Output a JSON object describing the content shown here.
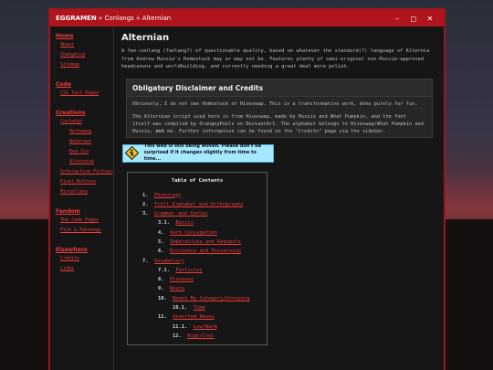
{
  "window": {
    "breadcrumb": [
      "EGGRAMEN",
      "Conlangs",
      "Alternian"
    ],
    "separator": "»",
    "controls": {
      "minimize": "–",
      "maximize": "◻",
      "close": "✕"
    }
  },
  "sidebar": {
    "sections": [
      {
        "heading": "Home",
        "items": [
          {
            "label": "About",
            "level": 1
          },
          {
            "label": "Changelog",
            "level": 1
          },
          {
            "label": "Sitemap",
            "level": 1
          }
        ]
      },
      {
        "heading": "Code",
        "items": [
          {
            "label": "CSS Test Pages",
            "level": 1
          }
        ]
      },
      {
        "heading": "Creations",
        "items": [
          {
            "label": "Conlangs",
            "level": 1
          },
          {
            "label": "Helhemag",
            "level": 2
          },
          {
            "label": "Nateraan",
            "level": 2
          },
          {
            "label": "Ewa Zio",
            "level": 2
          },
          {
            "label": "Alternian",
            "level": 2
          },
          {
            "label": "Interactive Fiction",
            "level": 1
          },
          {
            "label": "Pixel Buttons",
            "level": 1
          },
          {
            "label": "Miscellany",
            "level": 1
          }
        ]
      },
      {
        "heading": "Fandom",
        "items": [
          {
            "label": "The Jade Pages",
            "level": 1
          },
          {
            "label": "Filk & Fansongs",
            "level": 1
          }
        ]
      },
      {
        "heading": "Elsewhere",
        "items": [
          {
            "label": "Credits",
            "level": 1
          },
          {
            "label": "Links",
            "level": 1
          }
        ]
      }
    ]
  },
  "main": {
    "title": "Alternian",
    "intro": "A fan-conlang (fanlang?) of questionable quality, based on whatever the standard(?) language of Alternia from Andrew Hussie's Homestuck may or may not be. Features plenty of semi-original non-Hussie-approved headcanons and worldbuilding, and currently needing a great deal more polish.",
    "disclaimer": {
      "heading": "Obligatory Disclaimer and Credits",
      "p1": "Obviously, I do not own Homestuck or Hiveswap. This is a transformative work, done purely for fun.",
      "p2_a": "The Alternian script used here is from Hiveswap, made by Hussie and What Pumpkin, and the font itself was compiled by OrangeyPeels on DeviantArt. The alphabet belongs to Hiveswap/What Pumpkin and Hussie, ",
      "p2_not": "not",
      "p2_b": " me. Further information can be found on the ",
      "p2_link": "\"Credits\"",
      "p2_c": " page via the sidebar."
    },
    "notice": {
      "line1": "This web is still being woven. Please don't be",
      "line2": "surprised if it changes slightly from time to time..."
    },
    "toc": {
      "title": "Table of Contents",
      "entries": [
        {
          "num": "1.",
          "label": "Phonology",
          "indent": 0
        },
        {
          "num": "2.",
          "label": "Troll Alphabet and Orthography",
          "indent": 0
        },
        {
          "num": "3.",
          "label": "Grammar and Syntax",
          "indent": 0
        },
        {
          "num": "3.1.",
          "label": "Basics",
          "indent": 1
        },
        {
          "num": "4.",
          "label": "Verb Conjugation",
          "indent": 1
        },
        {
          "num": "5.",
          "label": "Imperatives and Requests",
          "indent": 1
        },
        {
          "num": "6.",
          "label": "Existence and Possession",
          "indent": 1
        },
        {
          "num": "7.",
          "label": "Vocabulary",
          "indent": 0
        },
        {
          "num": "7.1.",
          "label": "Particles",
          "indent": 1
        },
        {
          "num": "8.",
          "label": "Pronouns",
          "indent": 1
        },
        {
          "num": "9.",
          "label": "Nouns",
          "indent": 1
        },
        {
          "num": "10.",
          "label": "Nouns By Category/Grouping",
          "indent": 1
        },
        {
          "num": "10.1.",
          "label": "Time",
          "indent": 2
        },
        {
          "num": "11.",
          "label": "Unsorted Nouns",
          "indent": 1
        },
        {
          "num": "11.1.",
          "label": "Low/Warm",
          "indent": 2
        },
        {
          "num": "12.",
          "label": "High/Cool",
          "indent": 2
        }
      ]
    }
  },
  "colors": {
    "accent": "#ee3a3a",
    "titlebar": "#b0141c",
    "notice_bg": "#a6e8ff"
  }
}
